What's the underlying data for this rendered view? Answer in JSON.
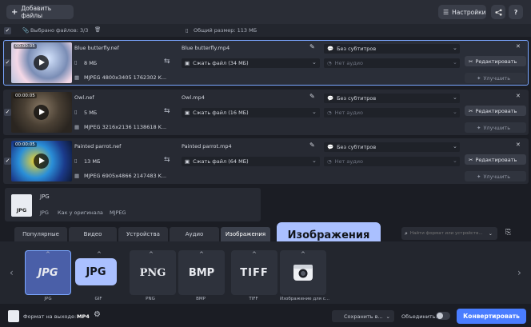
{
  "topbar": {
    "add_files": "Добавить файлы",
    "settings": "Настройки",
    "help": "?"
  },
  "selection": {
    "selected": "Выбрано файлов: 3/3",
    "total_size": "Общий размер: 113 МБ"
  },
  "files": [
    {
      "duration": "00:00:05",
      "name": "Blue butterfly.nef",
      "size": "8 МБ",
      "meta": "MJPEG 4800x3405 1762302 K...",
      "output_name": "Blue butterfly.mp4",
      "compress": "Сжать файл (34 МБ)",
      "subtitles": "Без субтитров",
      "audio": "Нет аудио",
      "edit": "Редактировать",
      "enhance": "Улучшить"
    },
    {
      "duration": "00:00:05",
      "name": "Owl.nef",
      "size": "5 МБ",
      "meta": "MJPEG 3216x2136 1138618 K...",
      "output_name": "Owl.mp4",
      "compress": "Сжать файл (16 МБ)",
      "subtitles": "Без субтитров",
      "audio": "Нет аудио",
      "edit": "Редактировать",
      "enhance": "Улучшить"
    },
    {
      "duration": "00:00:05",
      "name": "Painted parrot.nef",
      "size": "13 МБ",
      "meta": "MJPEG 6905x4866 2147483 K...",
      "output_name": "Painted parrot.mp4",
      "compress": "Сжать файл (64 МБ)",
      "subtitles": "Без субтитров",
      "audio": "Нет аудио",
      "edit": "Редактировать",
      "enhance": "Улучшить"
    }
  ],
  "preset": {
    "icon_text": "JPG",
    "title": "JPG",
    "details": [
      "JPG",
      "Как у оригинала",
      "MJPEG"
    ]
  },
  "tabs": [
    "Популярные",
    "Видео",
    "Устройства",
    "Аудио",
    "Изображения"
  ],
  "tooltip_tab": "Изображения",
  "search": {
    "placeholder": "Найти формат или устройств..."
  },
  "formats": [
    {
      "name": "JPG",
      "label": "JPG"
    },
    {
      "name": "GIF",
      "label": "GIF"
    },
    {
      "name": "PNG",
      "label": "PNG"
    },
    {
      "name": "BMP",
      "label": "BMP"
    },
    {
      "name": "TIFF",
      "label": "TIFF"
    },
    {
      "name": "",
      "label": "Изображение для с..."
    }
  ],
  "tooltip_format": "JPG",
  "bottom": {
    "output_format_label": "Формат на выходе:",
    "output_format": "MP4",
    "save": "Сохранить в...",
    "merge": "Объединить:",
    "convert": "Конвертировать"
  },
  "colors": {
    "accent": "#4a7dff",
    "selection": "#7aa6ff",
    "tooltip": "#aac0ff"
  }
}
